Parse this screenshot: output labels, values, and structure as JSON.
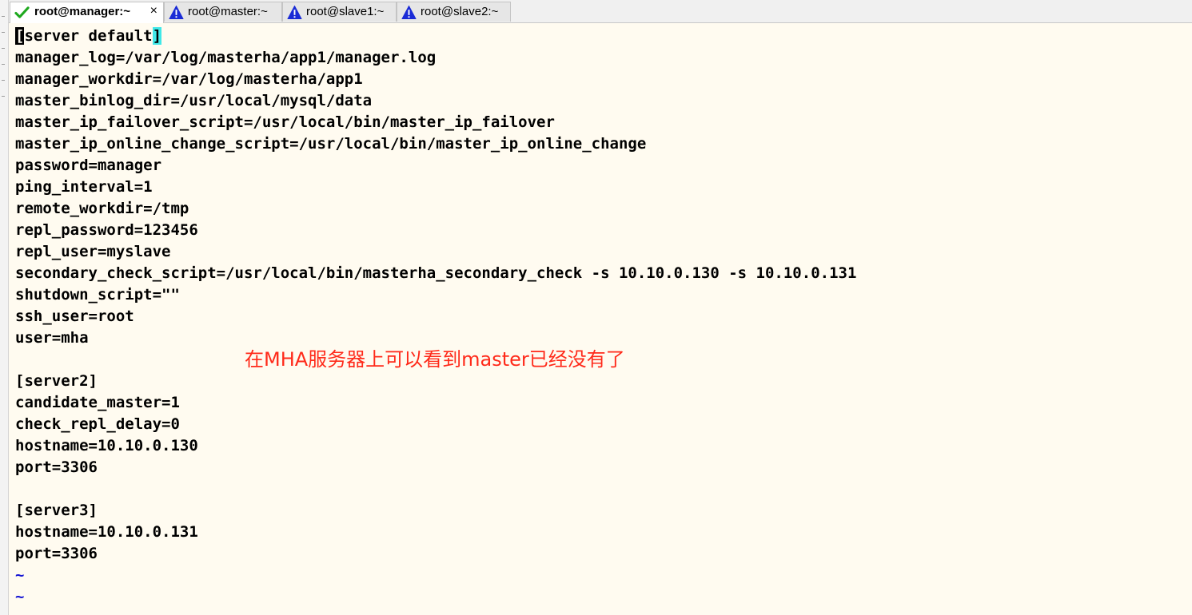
{
  "tabs": [
    {
      "label": "root@manager:~",
      "status": "connected",
      "icon": "checkmark-icon",
      "active": true,
      "close": "×"
    },
    {
      "label": "root@master:~",
      "status": "warning",
      "icon": "warning-triangle-icon",
      "active": false
    },
    {
      "label": "root@slave1:~",
      "status": "warning",
      "icon": "warning-triangle-icon",
      "active": false
    },
    {
      "label": "root@slave2:~",
      "status": "warning",
      "icon": "warning-triangle-icon",
      "active": false
    }
  ],
  "terminal": {
    "first_line": {
      "cursor_char": "[",
      "middle": "server default",
      "highlight_char": "]"
    },
    "lines": [
      "manager_log=/var/log/masterha/app1/manager.log",
      "manager_workdir=/var/log/masterha/app1",
      "master_binlog_dir=/usr/local/mysql/data",
      "master_ip_failover_script=/usr/local/bin/master_ip_failover",
      "master_ip_online_change_script=/usr/local/bin/master_ip_online_change",
      "password=manager",
      "ping_interval=1",
      "remote_workdir=/tmp",
      "repl_password=123456",
      "repl_user=myslave",
      "secondary_check_script=/usr/local/bin/masterha_secondary_check -s 10.10.0.130 -s 10.10.0.131",
      "shutdown_script=\"\"",
      "ssh_user=root",
      "user=mha",
      "",
      "[server2]",
      "candidate_master=1",
      "check_repl_delay=0",
      "hostname=10.10.0.130",
      "port=3306",
      "",
      "[server3]",
      "hostname=10.10.0.131",
      "port=3306"
    ],
    "tilde_lines": [
      "~",
      "~"
    ]
  },
  "annotation": "在MHA服务器上可以看到master已经没有了",
  "colors": {
    "terminal_bg": "#fffbf0",
    "annotation": "#ff2a1a",
    "tilde": "#1414d4",
    "bracket_highlight": "#40e8e8",
    "check": "#1ea81e",
    "warning": "#1a2bd6"
  }
}
